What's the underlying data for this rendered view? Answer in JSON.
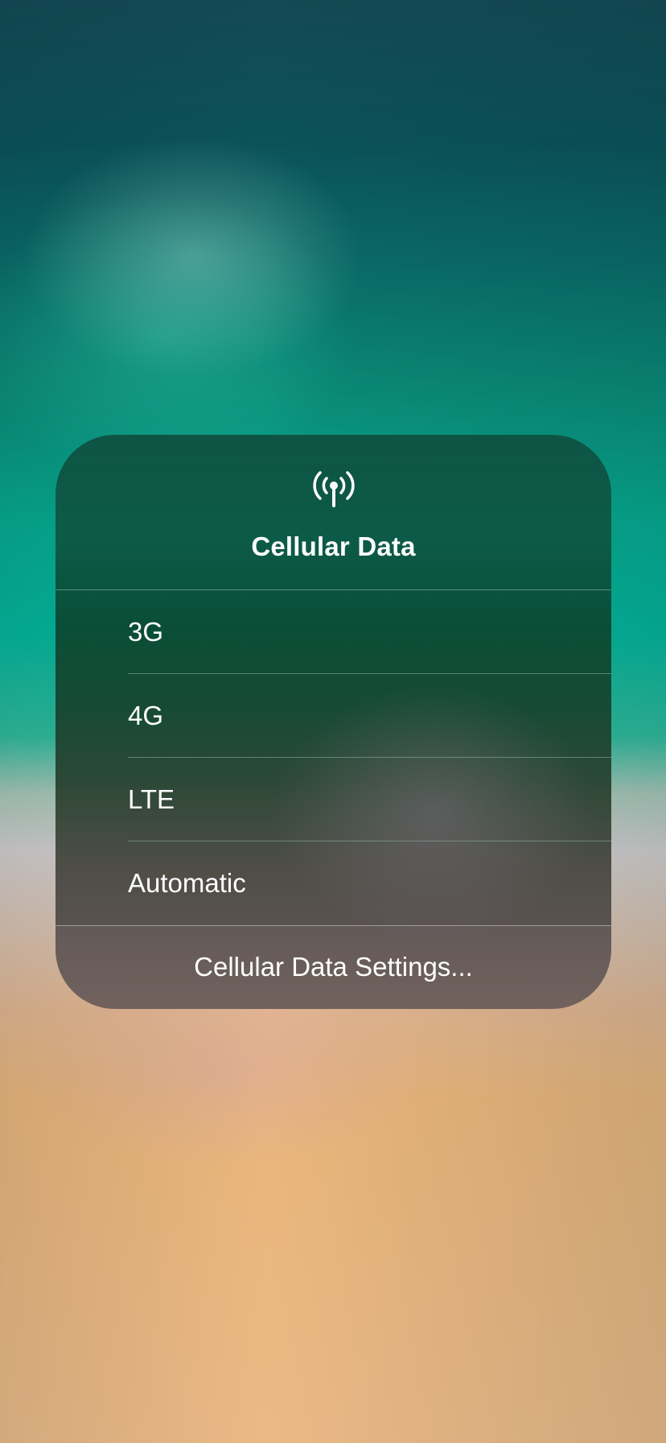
{
  "menu": {
    "icon": "cellular-antenna-icon",
    "title": "Cellular Data",
    "options": [
      {
        "label": "3G"
      },
      {
        "label": "4G"
      },
      {
        "label": "LTE"
      },
      {
        "label": "Automatic"
      }
    ],
    "settings_label": "Cellular Data Settings..."
  }
}
